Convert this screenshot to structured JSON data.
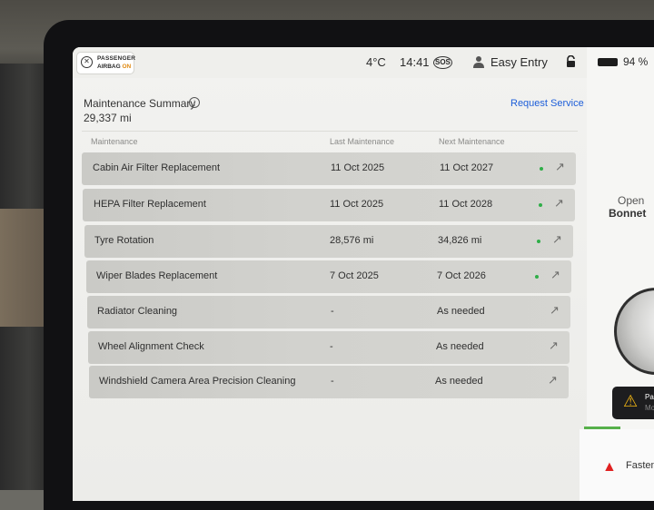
{
  "status_bar": {
    "airbag_line1": "PASSENGER",
    "airbag_line2": "AIRBAG",
    "airbag_state": "ON",
    "temperature": "4°C",
    "time": "14:41",
    "sos": "SOS",
    "profile_name": "Easy Entry",
    "battery_percent": "94 %"
  },
  "maintenance": {
    "title": "Maintenance Summary",
    "odometer": "29,337  mi",
    "request_service_label": "Request Service",
    "columns": {
      "name": "Maintenance",
      "last": "Last Maintenance",
      "next": "Next Maintenance"
    },
    "rows": [
      {
        "name": "Cabin Air Filter Replacement",
        "last": "11 Oct 2025",
        "next": "11 Oct 2027",
        "status_dot": true
      },
      {
        "name": "HEPA Filter Replacement",
        "last": "11 Oct 2025",
        "next": "11 Oct 2028",
        "status_dot": true
      },
      {
        "name": "Tyre Rotation",
        "last": "28,576 mi",
        "next": "34,826 mi",
        "status_dot": true
      },
      {
        "name": "Wiper Blades Replacement",
        "last": "7 Oct 2025",
        "next": "7 Oct 2026",
        "status_dot": true
      },
      {
        "name": "Radiator Cleaning",
        "last": "-",
        "next": "As needed",
        "status_dot": false
      },
      {
        "name": "Wheel Alignment Check",
        "last": "-",
        "next": "As needed",
        "status_dot": false
      },
      {
        "name": "Windshield Camera Area Precision Cleaning",
        "last": "-",
        "next": "As needed",
        "status_dot": false
      }
    ]
  },
  "side_panel": {
    "open_label": "Open",
    "bonnet_label": "Bonnet",
    "alert_text_1": "Pa",
    "alert_text_2": "Mo",
    "warning_text": "Fasten"
  },
  "colors": {
    "accent_link": "#1d5ed9",
    "status_ok": "#2fae48",
    "airbag_on": "#e08a12",
    "warning": "#e02020"
  },
  "icons": [
    "airbag-off-icon",
    "info-icon",
    "person-icon",
    "lock-icon",
    "battery-icon",
    "external-link-arrow-icon",
    "warning-triangle-icon",
    "alert-triangle-icon"
  ]
}
